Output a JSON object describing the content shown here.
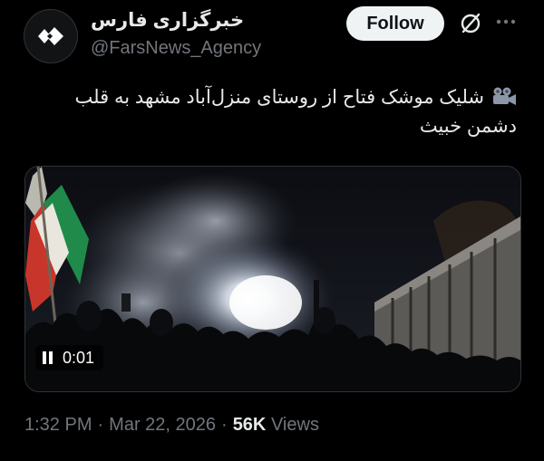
{
  "account": {
    "display_name": "خبرگزاری فارس",
    "handle": "@FarsNews_Agency",
    "avatar_icon": "fars-logo-icon"
  },
  "actions": {
    "follow_label": "Follow",
    "grok_icon": "grok-icon",
    "more_icon": "more-icon"
  },
  "tweet": {
    "lead_icon": "video-camera-icon",
    "text": "شلیک موشک فتاح از روستای منزل‌آباد مشهد به قلب دشمن خبیث"
  },
  "media": {
    "type": "video",
    "timestamp": "0:01",
    "state": "playing",
    "control_icon": "pause-icon"
  },
  "meta": {
    "time": "1:32 PM",
    "date": "Mar 22, 2026",
    "separator": "·",
    "views_count": "56K",
    "views_label": "Views"
  },
  "colors": {
    "background": "#000000",
    "text_primary": "#e7e9ea",
    "text_secondary": "#71767b",
    "button_bg": "#eff3f4",
    "button_text": "#0f1419"
  }
}
